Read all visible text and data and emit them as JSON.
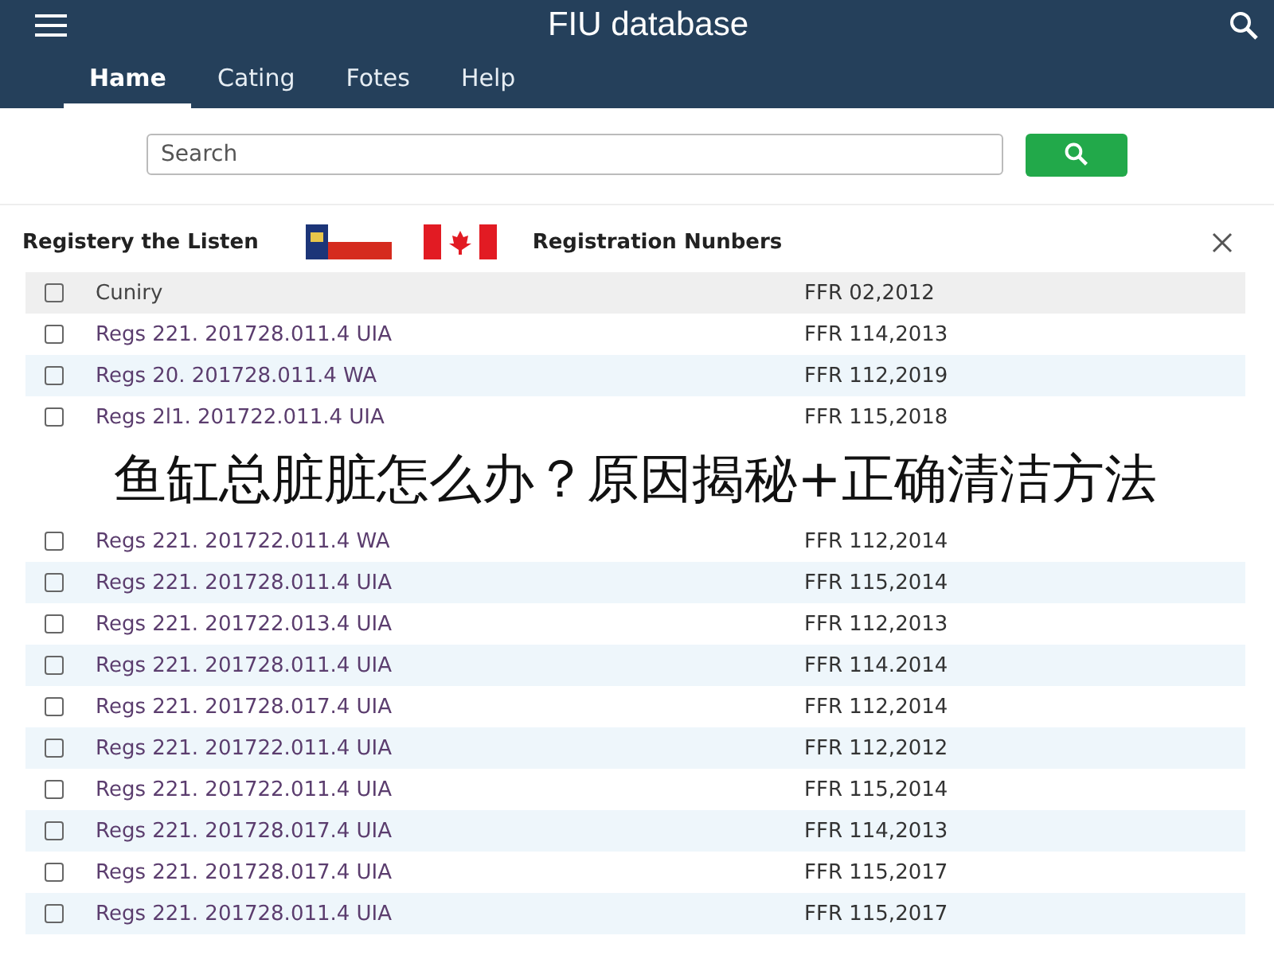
{
  "app_bar": {
    "title": "FIU database"
  },
  "tabs": [
    {
      "label": "Hame",
      "selected": true
    },
    {
      "label": "Cating",
      "selected": false
    },
    {
      "label": "Fotes",
      "selected": false
    },
    {
      "label": "Help",
      "selected": false
    }
  ],
  "search": {
    "placeholder": "Search"
  },
  "panel": {
    "title": "Registery the Listen",
    "subtitle": "Registration Nunbers"
  },
  "table": {
    "header": {
      "column_1": "Cuniry",
      "column_2": "FFR 02,2012",
      "checked": false
    },
    "rows_before_banner": [
      {
        "column_1": "Regs 221. 201728.011.4 UIA",
        "column_2": "FFR 114,2013",
        "checked": false
      },
      {
        "column_1": "Regs 20. 201728.011.4 WA",
        "column_2": "FFR 112,2019",
        "checked": false
      },
      {
        "column_1": "Regs 2l1. 201722.011.4 UIA",
        "column_2": "FFR 115,2018",
        "checked": false
      }
    ],
    "rows_after_banner": [
      {
        "column_1": "Regs 221. 201722.011.4 WA",
        "column_2": "FFR 112,2014",
        "checked": false
      },
      {
        "column_1": "Regs 221. 201728.011.4 UIA",
        "column_2": "FFR 115,2014",
        "checked": false
      },
      {
        "column_1": "Regs 221. 201722.013.4 UIA",
        "column_2": "FFR 112,2013",
        "checked": false
      },
      {
        "column_1": "Regs 221. 201728.011.4 UIA",
        "column_2": "FFR 114.2014",
        "checked": false
      },
      {
        "column_1": "Regs 221. 201728.017.4 UIA",
        "column_2": "FFR 112,2014",
        "checked": false
      },
      {
        "column_1": "Regs 221. 201722.011.4 UIA",
        "column_2": "FFR 112,2012",
        "checked": false
      },
      {
        "column_1": "Regs 221. 201722.011.4 UIA",
        "column_2": "FFR 115,2014",
        "checked": false
      },
      {
        "column_1": "Regs 221. 201728.017.4 UIA",
        "column_2": "FFR 114,2013",
        "checked": false
      },
      {
        "column_1": "Regs 221. 201728.017.4 UIA",
        "column_2": "FFR 115,2017",
        "checked": false
      },
      {
        "column_1": "Regs 221. 201728.011.4 UIA",
        "column_2": "FFR 115,2017",
        "checked": false
      }
    ]
  },
  "banner": {
    "text": "鱼缸总脏脏怎么办？原因揭秘+正确清洁方法"
  }
}
